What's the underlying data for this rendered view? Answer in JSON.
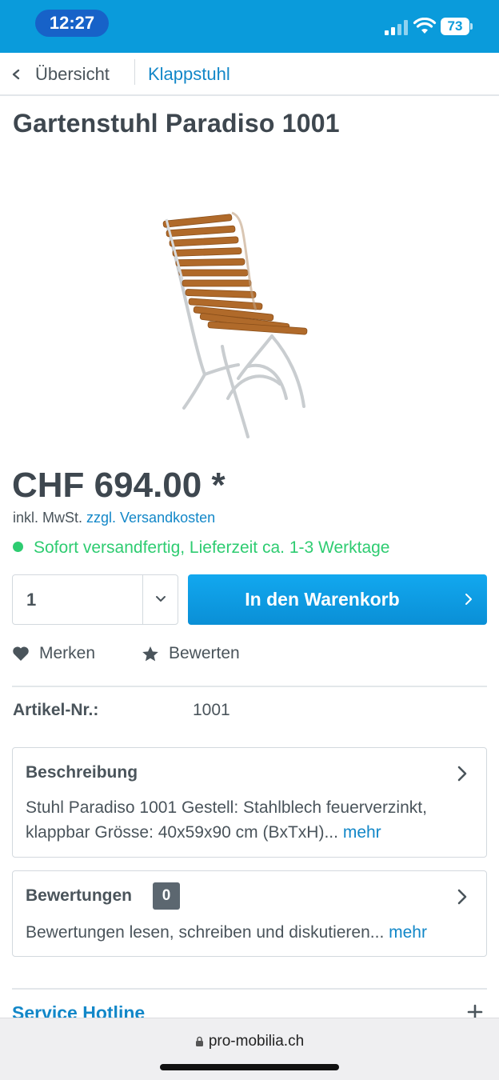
{
  "status_bar": {
    "time": "12:27",
    "battery": "73"
  },
  "breadcrumb": {
    "back_label": "Übersicht",
    "current": "Klappstuhl"
  },
  "product": {
    "title": "Gartenstuhl Paradiso 1001",
    "price": "CHF 694.00 *",
    "tax_prefix": "inkl. MwSt.",
    "shipping_link": "zzgl. Versandkosten",
    "delivery": "Sofort versandfertig, Lieferzeit ca. 1-3 Werktage",
    "image_icon": "garden-chair-image"
  },
  "buy": {
    "quantity": "1",
    "cart_label": "In den Warenkorb"
  },
  "actions": {
    "remember": "Merken",
    "rate": "Bewerten"
  },
  "article": {
    "label": "Artikel-Nr.:",
    "value": "1001"
  },
  "description": {
    "title": "Beschreibung",
    "text": "Stuhl Paradiso 1001 Gestell: Stahlblech feuerverzinkt, klappbar Grösse: 40x59x90 cm (BxTxH)...",
    "more": "mehr"
  },
  "reviews": {
    "title": "Bewertungen",
    "count": "0",
    "text": "Bewertungen lesen, schreiben und diskutieren...",
    "more": "mehr"
  },
  "service": {
    "title": "Service Hotline"
  },
  "browser": {
    "url": "pro-mobilia.ch"
  },
  "colors": {
    "brand": "#0a9bdb",
    "link": "#1287c8",
    "success": "#2ecc71",
    "text": "#4a545b"
  }
}
